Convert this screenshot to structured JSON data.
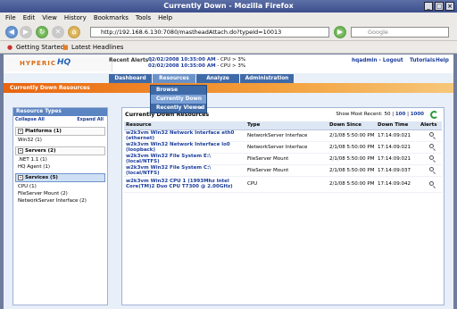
{
  "window": {
    "title": "Currently Down - Mozilla Firefox"
  },
  "menubar": {
    "items": [
      "File",
      "Edit",
      "View",
      "History",
      "Bookmarks",
      "Tools",
      "Help"
    ]
  },
  "navbar": {
    "url": "http://192.168.6.130:7080/mastheadAttach.do?typeId=10013",
    "search_placeholder": "Google"
  },
  "bookmarks": {
    "items": [
      "Getting Started",
      "Latest Headlines"
    ]
  },
  "masthead": {
    "logo_text": "HYPERIC",
    "logo_hq": "HQ",
    "recent_alerts_label": "Recent Alerts :",
    "alerts": [
      {
        "time": "02/02/2008 10:35:00 AM",
        "msg": "- CPU > 3%"
      },
      {
        "time": "02/02/2008 10:35:00 AM",
        "msg": "- CPU > 3%"
      }
    ],
    "links": [
      "hqadmin - Logout",
      "Tutorials",
      "Help"
    ]
  },
  "tabs": [
    "Dashboard",
    "Resources",
    "Analyze",
    "Administration"
  ],
  "dropdown": {
    "items": [
      "Browse",
      "Currently Down",
      "Recently Viewed"
    ]
  },
  "page_title": "Currently Down Resources",
  "left_panel": {
    "header": "Resource Types",
    "collapse_all": "Collapse All",
    "expand_all": "Expand All",
    "platforms": {
      "label": "Platforms (1)",
      "items": [
        "Win32 (1)"
      ]
    },
    "servers": {
      "label": "Servers (2)",
      "items": [
        ".NET 1.1 (1)",
        "HQ Agent (1)"
      ]
    },
    "services": {
      "label": "Services (5)",
      "items": [
        "CPU (1)",
        "FileServer Mount (2)",
        "NetworkServer Interface (2)"
      ]
    }
  },
  "main_panel": {
    "header_text": "Currently Down Resources",
    "show_most_recent": "Show Most Recent:",
    "counts": [
      "50",
      "100",
      "1000"
    ],
    "columns": [
      "Resource",
      "Type",
      "Down Since",
      "Down Time",
      "Alerts"
    ],
    "rows": [
      {
        "resource": "w2k3vm Win32 Network Interface eth0 (ethernet)",
        "type": "NetworkServer Interface",
        "down_since": "2/1/08 5:50:00 PM",
        "down_time": "17:14:09:021"
      },
      {
        "resource": "w2k3vm Win32 Network Interface lo0 (loopback)",
        "type": "NetworkServer Interface",
        "down_since": "2/1/08 5:50:00 PM",
        "down_time": "17:14:09:021"
      },
      {
        "resource": "w2k3vm Win32 File System E:\\ (local/NTFS)",
        "type": "FileServer Mount",
        "down_since": "2/1/08 5:50:00 PM",
        "down_time": "17:14:09:021"
      },
      {
        "resource": "w2k3vm Win32 File System C:\\ (local/NTFS)",
        "type": "FileServer Mount",
        "down_since": "2/1/08 5:50:00 PM",
        "down_time": "17:14:09:037"
      },
      {
        "resource": "w2k3vm Win32 CPU 1 (1993Mhz Intel Core(TM)2 Duo CPU T7300 @ 2.00GHz)",
        "type": "CPU",
        "down_since": "2/1/08 5:50:00 PM",
        "down_time": "17:14:09:042"
      }
    ]
  }
}
